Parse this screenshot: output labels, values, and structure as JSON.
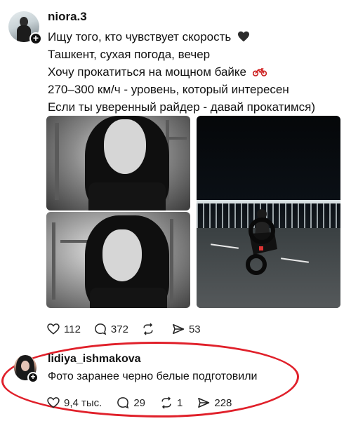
{
  "post": {
    "username": "niora.3",
    "lines": [
      "Ищу того, кто чувствует скорость",
      "Ташкент, сухая погода, вечер",
      "Хочу прокатиться на мощном байке",
      "270–300 км/ч -  уровень, который интересен",
      "Если ты уверенный райдер - давай прокатимся)"
    ],
    "emojis": {
      "line1": "black-heart-icon",
      "line3": "motorcycle-icon"
    },
    "media": [
      "photo-selfie-gym-1",
      "photo-selfie-gym-2",
      "photo-motorcycle-wheelie-night"
    ],
    "actions": {
      "likes": "112",
      "comments": "372",
      "reposts": "",
      "shares": "53"
    }
  },
  "reply": {
    "username": "lidiya_ishmakova",
    "text": "Фото заранее черно белые подготовили",
    "actions": {
      "likes": "9,4 тыс.",
      "comments": "29",
      "reposts": "1",
      "shares": "228"
    },
    "highlight_color": "#e0202a"
  }
}
